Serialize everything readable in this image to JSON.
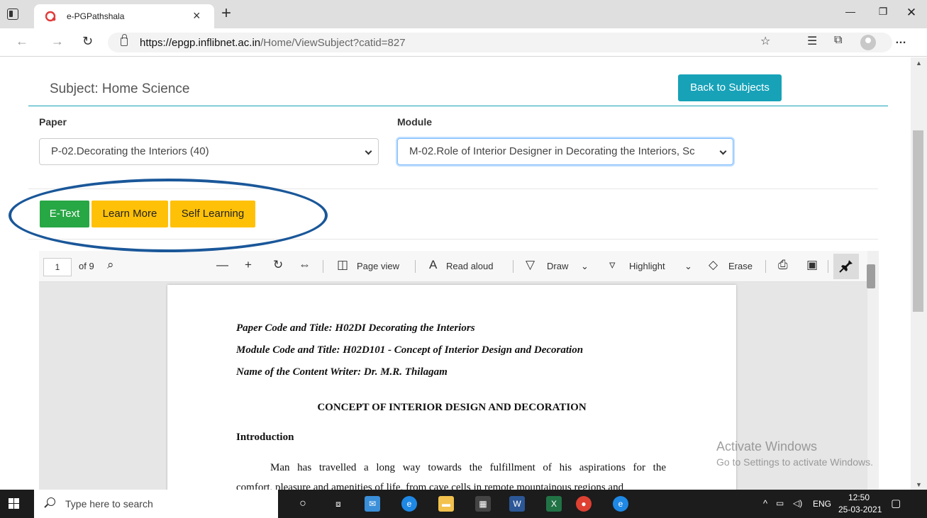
{
  "browser": {
    "tab_title": "e-PGPathshala",
    "url_host": "https://epgp.inflibnet.ac.in",
    "url_path": "/Home/ViewSubject?catid=827"
  },
  "page": {
    "subject_title": "Subject: Home Science",
    "back_button": "Back to Subjects",
    "paper_label": "Paper",
    "paper_value": "P-02.Decorating the Interiors (40)",
    "module_label": "Module",
    "module_value": "M-02.Role of Interior Designer in Decorating the Interiors, Sc",
    "buttons": {
      "etext": "E-Text",
      "learn_more": "Learn More",
      "self_learning": "Self Learning"
    }
  },
  "pdf_viewer": {
    "page_number": "1",
    "page_count": "of 9",
    "page_view": "Page view",
    "read_aloud": "Read aloud",
    "draw": "Draw",
    "highlight": "Highlight",
    "erase": "Erase"
  },
  "document": {
    "paper_code": "Paper Code and Title: H02DI Decorating the Interiors",
    "module_code": "Module Code and Title: H02D101 - Concept of Interior Design and Decoration",
    "writer": "Name of the Content Writer: Dr. M.R. Thilagam",
    "heading": "CONCEPT OF INTERIOR DESIGN AND DECORATION",
    "subheading": "Introduction",
    "para_line1": "Man has travelled a long way towards the fulfillment of his aspirations for the",
    "para_line2": "comfort, pleasure and amenities of life, from cave cells in remote mountainous regions and"
  },
  "watermark": {
    "line1": "Activate Windows",
    "line2": "Go to Settings to activate Windows."
  },
  "taskbar": {
    "search_placeholder": "Type here to search",
    "language": "ENG",
    "time": "12:50",
    "date": "25-03-2021"
  },
  "colors": {
    "teal": "#17a2b8",
    "green": "#28a745",
    "yellow": "#ffc107",
    "annotation_ellipse": "#1a5799"
  }
}
